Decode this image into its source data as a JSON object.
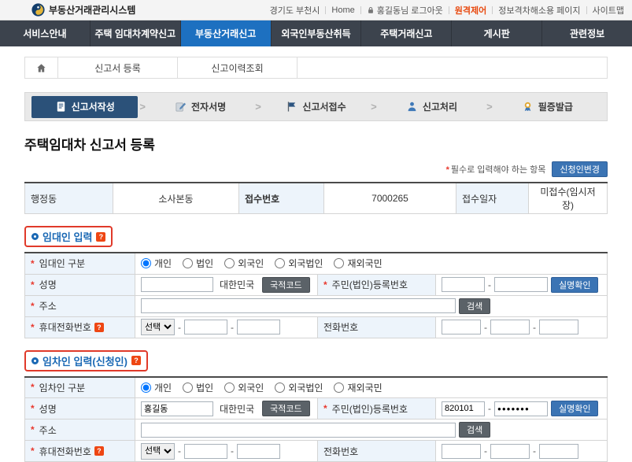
{
  "topbar": {
    "logo": "부동산거래관리시스템",
    "links": [
      "경기도 부천시",
      "Home",
      "홍길동님 로그아웃",
      "원격제어",
      "정보격차해소용 페이지",
      "사이트맵"
    ]
  },
  "nav": {
    "items": [
      {
        "label": "서비스안내"
      },
      {
        "label": "주택 임대차계약신고"
      },
      {
        "label": "부동산거래신고"
      },
      {
        "label": "외국인부동산취득"
      },
      {
        "label": "주택거래신고"
      },
      {
        "label": "게시판"
      },
      {
        "label": "관련정보"
      }
    ]
  },
  "breadcrumb": {
    "items": [
      "신고서 등록",
      "신고이력조회"
    ]
  },
  "steps": {
    "items": [
      {
        "label": "신고서작성"
      },
      {
        "label": "전자서명"
      },
      {
        "label": "신고서접수"
      },
      {
        "label": "신고처리"
      },
      {
        "label": "필증발급"
      }
    ]
  },
  "page": {
    "title": "주택임대차 신고서 등록",
    "required_star": "*",
    "required_note": "필수로 입력해야 하는 항목",
    "change_applicant": "신청인변경"
  },
  "summary": {
    "district_label": "행정동",
    "district": "소사본동",
    "receipt_no_label": "접수번호",
    "receipt_no": "7000265",
    "receipt_date_label": "접수일자",
    "receipt_date": "미접수(임시저장)"
  },
  "common": {
    "radio_options": [
      "개인",
      "법인",
      "외국인",
      "외국법인",
      "재외국민"
    ],
    "nationality": "대한민국",
    "btn_nationality": "국적코드",
    "btn_verify": "실명확인",
    "btn_search": "검색",
    "select_default": "선택",
    "name_label": "성명",
    "address_label": "주소",
    "mobile_label": "휴대전화번호",
    "regno_label": "주민(법인)등록번호",
    "phone_label": "전화번호"
  },
  "lessor": {
    "section_title": "임대인 입력",
    "type_label": "임대인 구분",
    "name": "",
    "address": "",
    "regno_front": "",
    "regno_back": ""
  },
  "tenant": {
    "section_title": "임차인 입력(신청인)",
    "type_label": "임차인 구분",
    "name": "홍길동",
    "address": "",
    "regno_front": "820101",
    "regno_back": "●●●●●●●"
  }
}
